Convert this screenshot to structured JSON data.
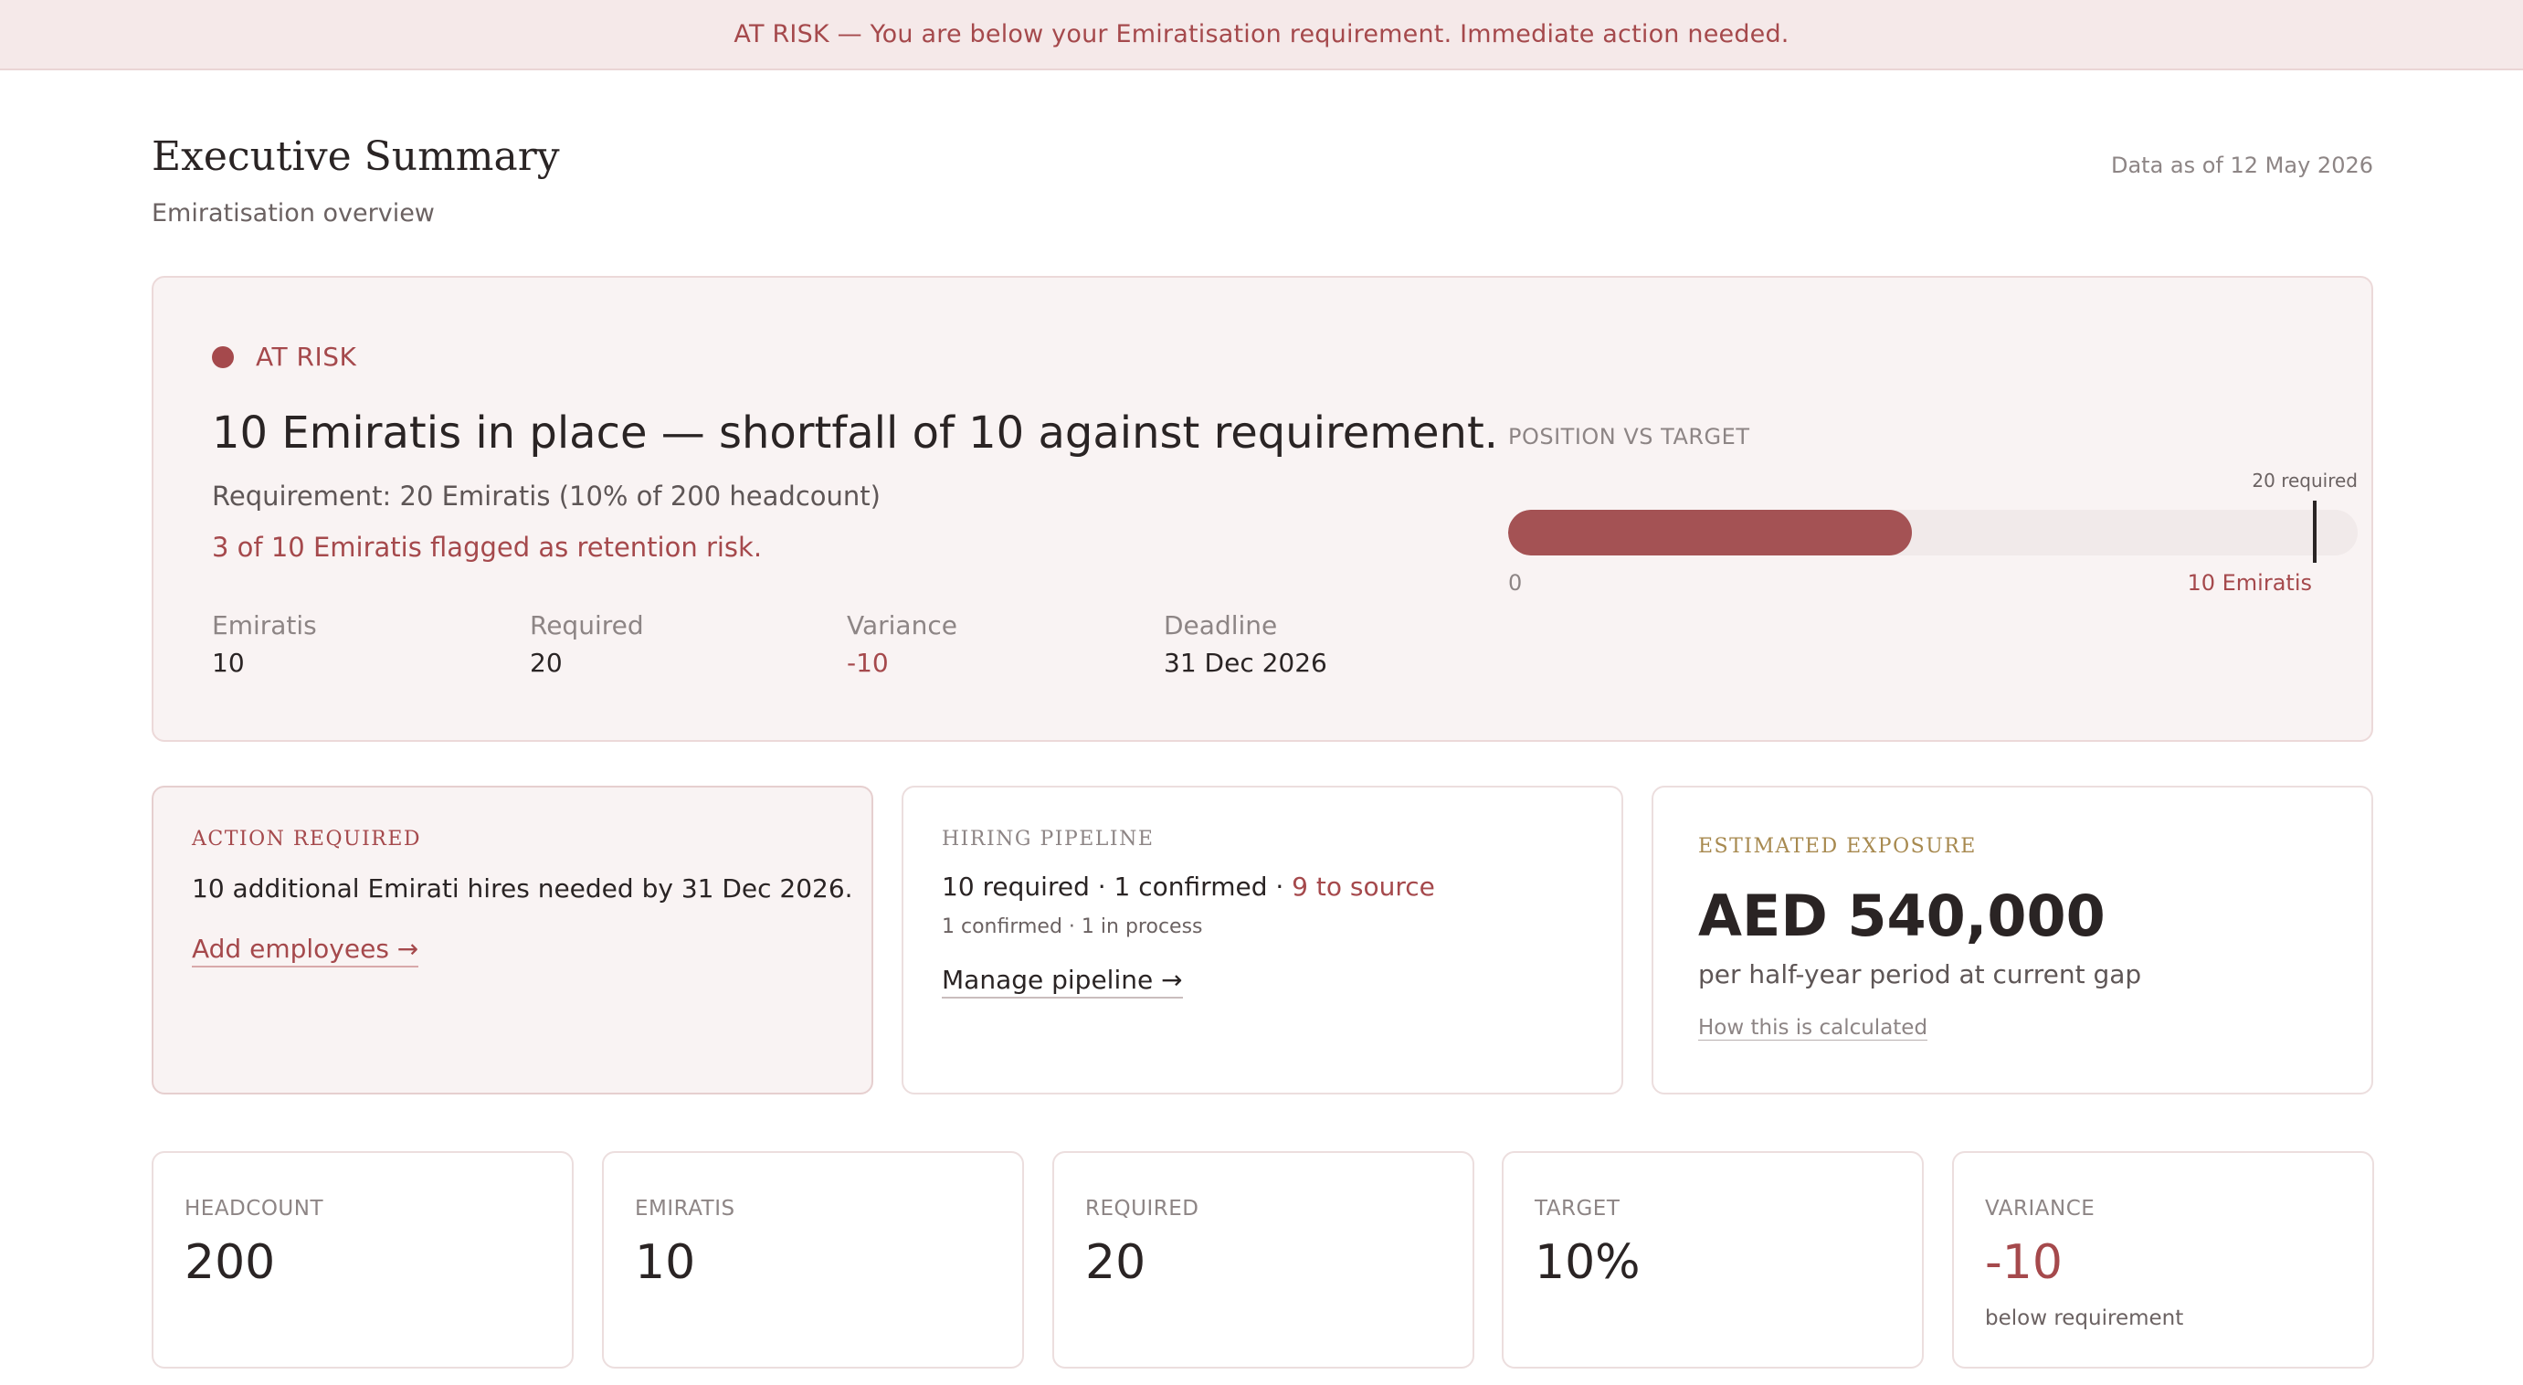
{
  "banner": {
    "text": "AT RISK — You are below your Emiratisation requirement. Immediate action needed."
  },
  "header": {
    "title": "Executive Summary",
    "subtitle": "Emiratisation overview",
    "data_as_of": "Data as of 12 May 2026"
  },
  "hero": {
    "status": "AT RISK",
    "headline": "10 Emiratis in place — shortfall of 10 against requirement.",
    "requirement": "Requirement: 20 Emiratis (10% of 200 headcount)",
    "retention_risk": "3 of 10 Emiratis flagged as retention risk.",
    "stats": [
      {
        "label": "Emiratis",
        "value": "10"
      },
      {
        "label": "Required",
        "value": "20"
      },
      {
        "label": "Variance",
        "value": "-10"
      },
      {
        "label": "Deadline",
        "value": "31 Dec 2026"
      }
    ],
    "position": {
      "title": "POSITION VS TARGET",
      "required_label": "20 required",
      "zero_label": "0",
      "current_label": "10 Emiratis",
      "current": 10,
      "required": 20,
      "fill_color": "#a45254"
    }
  },
  "cards": {
    "action": {
      "label": "ACTION REQUIRED",
      "text": "10 additional Emirati hires needed by 31 Dec 2026.",
      "link": "Add employees →"
    },
    "pipeline": {
      "label": "HIRING PIPELINE",
      "main": "10 required · 1 confirmed · ",
      "main_highlight": "9 to source",
      "sub": "1 confirmed · 1 in process",
      "link": "Manage pipeline →"
    },
    "exposure": {
      "label": "ESTIMATED EXPOSURE",
      "amount": "AED 540,000",
      "sub": "per half-year period at current gap",
      "link": "How this is calculated"
    }
  },
  "kpis": [
    {
      "label": "HEADCOUNT",
      "value": "200",
      "note": ""
    },
    {
      "label": "EMIRATIS",
      "value": "10",
      "note": ""
    },
    {
      "label": "REQUIRED",
      "value": "20",
      "note": ""
    },
    {
      "label": "TARGET",
      "value": "10%",
      "note": ""
    },
    {
      "label": "VARIANCE",
      "value": "-10",
      "note": "below requirement"
    }
  ],
  "colors": {
    "accent": "#a5494c",
    "banner_bg": "#f5e9e9",
    "gold": "#a7894f"
  }
}
